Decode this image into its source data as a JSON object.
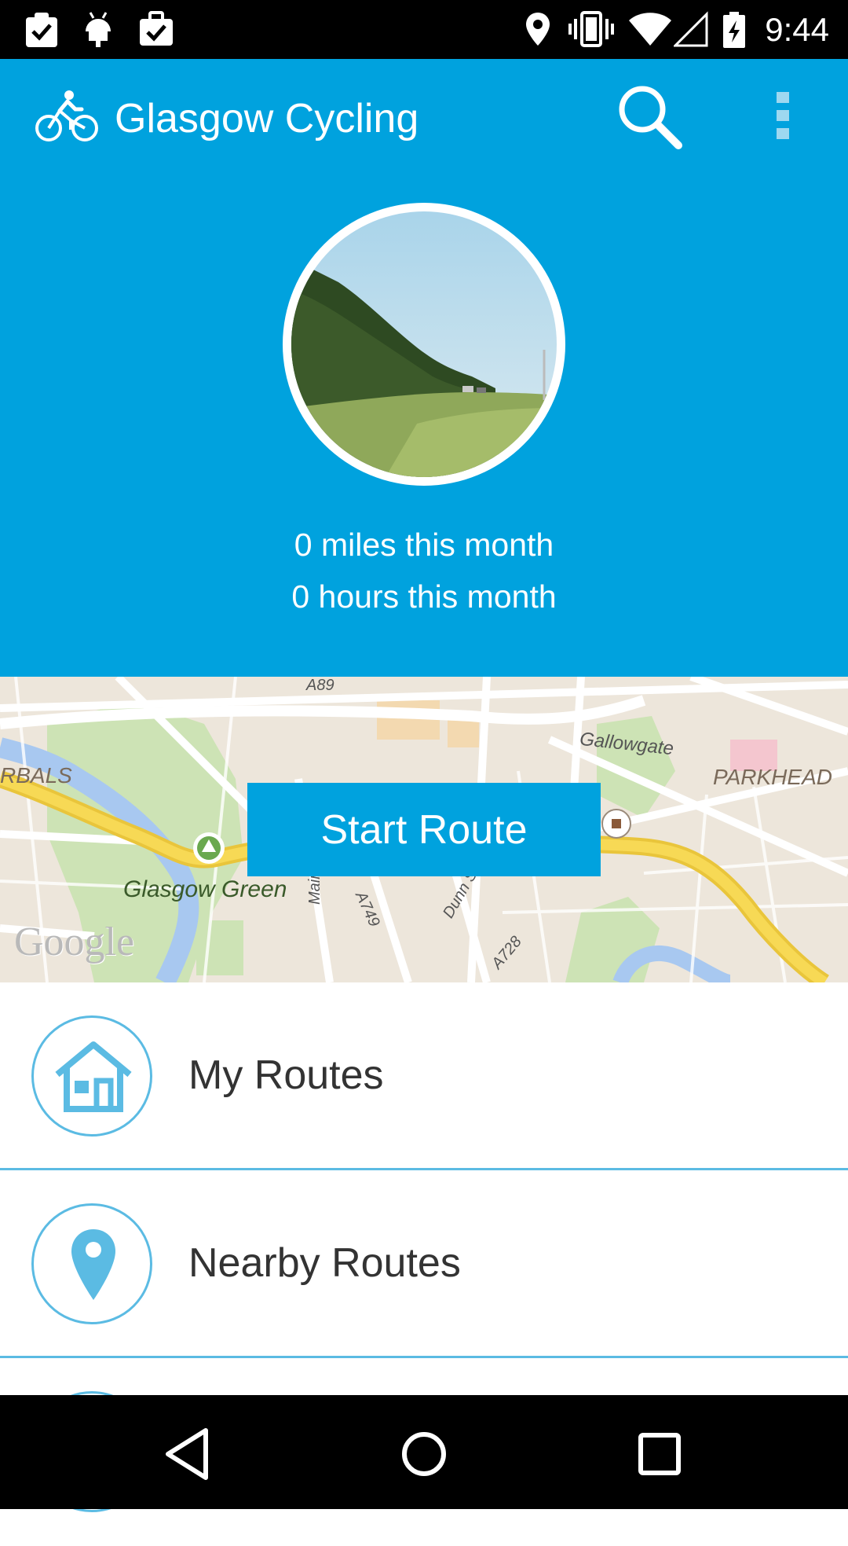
{
  "status_bar": {
    "time": "9:44",
    "left_icons": [
      "clipboard-check-icon",
      "android-icon",
      "briefcase-check-icon"
    ],
    "right_icons": [
      "location-icon",
      "vibrate-icon",
      "wifi-icon",
      "signal-icon",
      "battery-charging-icon"
    ]
  },
  "app_bar": {
    "title": "Glasgow Cycling",
    "logo_icon": "bicycle-icon",
    "actions": [
      "search-icon",
      "overflow-menu-icon"
    ]
  },
  "profile": {
    "miles_text": "0 miles this month",
    "hours_text": "0 hours this month"
  },
  "map": {
    "labels": {
      "a89": "A89",
      "gallowgate": "Gallowgate",
      "parkhead": "PARKHEAD",
      "gorbals": "RBALS",
      "glasgow_green": "Glasgow Green",
      "main_st": "Main St",
      "a749": "A749",
      "dunn_st": "Dunn St",
      "a728": "A728",
      "google": "Google"
    },
    "start_button": "Start Route"
  },
  "menu": {
    "items": [
      {
        "label": "My Routes",
        "icon": "home-icon"
      },
      {
        "label": "Nearby Routes",
        "icon": "map-pin-icon"
      }
    ]
  },
  "nav_bar": {
    "buttons": [
      "back-icon",
      "home-circle-icon",
      "recents-icon"
    ]
  },
  "colors": {
    "primary": "#00a2de",
    "accent_outline": "#5bbbe3",
    "status_bar": "#000000"
  }
}
